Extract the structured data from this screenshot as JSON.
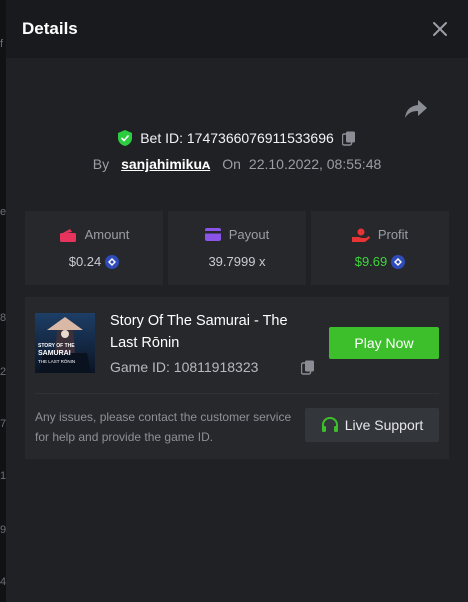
{
  "modal": {
    "title": "Details"
  },
  "bet": {
    "id_label": "Bet ID: 1747366076911533696",
    "by_label": "By",
    "username": "sanjahimikuᴀ",
    "on_label": "On",
    "datetime": "22.10.2022, 08:55:48"
  },
  "stats": {
    "amount": {
      "label": "Amount",
      "value": "$0.24",
      "icon": "wallet-icon",
      "icon_color": "#e8345c",
      "coin": "coin-icon"
    },
    "payout": {
      "label": "Payout",
      "value": "39.7999 x",
      "icon": "card-icon",
      "icon_color": "#8a55e6"
    },
    "profit": {
      "label": "Profit",
      "value": "$9.69",
      "icon": "hand-coins-icon",
      "icon_color": "#e83434",
      "value_color": "#3fd63a",
      "coin": "coin-icon"
    }
  },
  "game": {
    "title": "Story Of The Samurai - The Last Rōnin",
    "id_label": "Game ID: 10811918323",
    "thumb_text_1": "STORY OF THE",
    "thumb_text_2": "SAMURAI",
    "thumb_text_3": "THE LAST RŌNIN",
    "play_label": "Play Now"
  },
  "support": {
    "issues_text": "Any issues, please contact the customer service for help and provide the game ID.",
    "button_label": "Live Support"
  },
  "colors": {
    "accent_green": "#3cbf2b",
    "shield_green": "#2ecc40",
    "coin_blue": "#2f4bb8"
  },
  "background_chars": [
    "f",
    "e",
    "8",
    "2",
    "7",
    "1",
    "9",
    "4"
  ]
}
